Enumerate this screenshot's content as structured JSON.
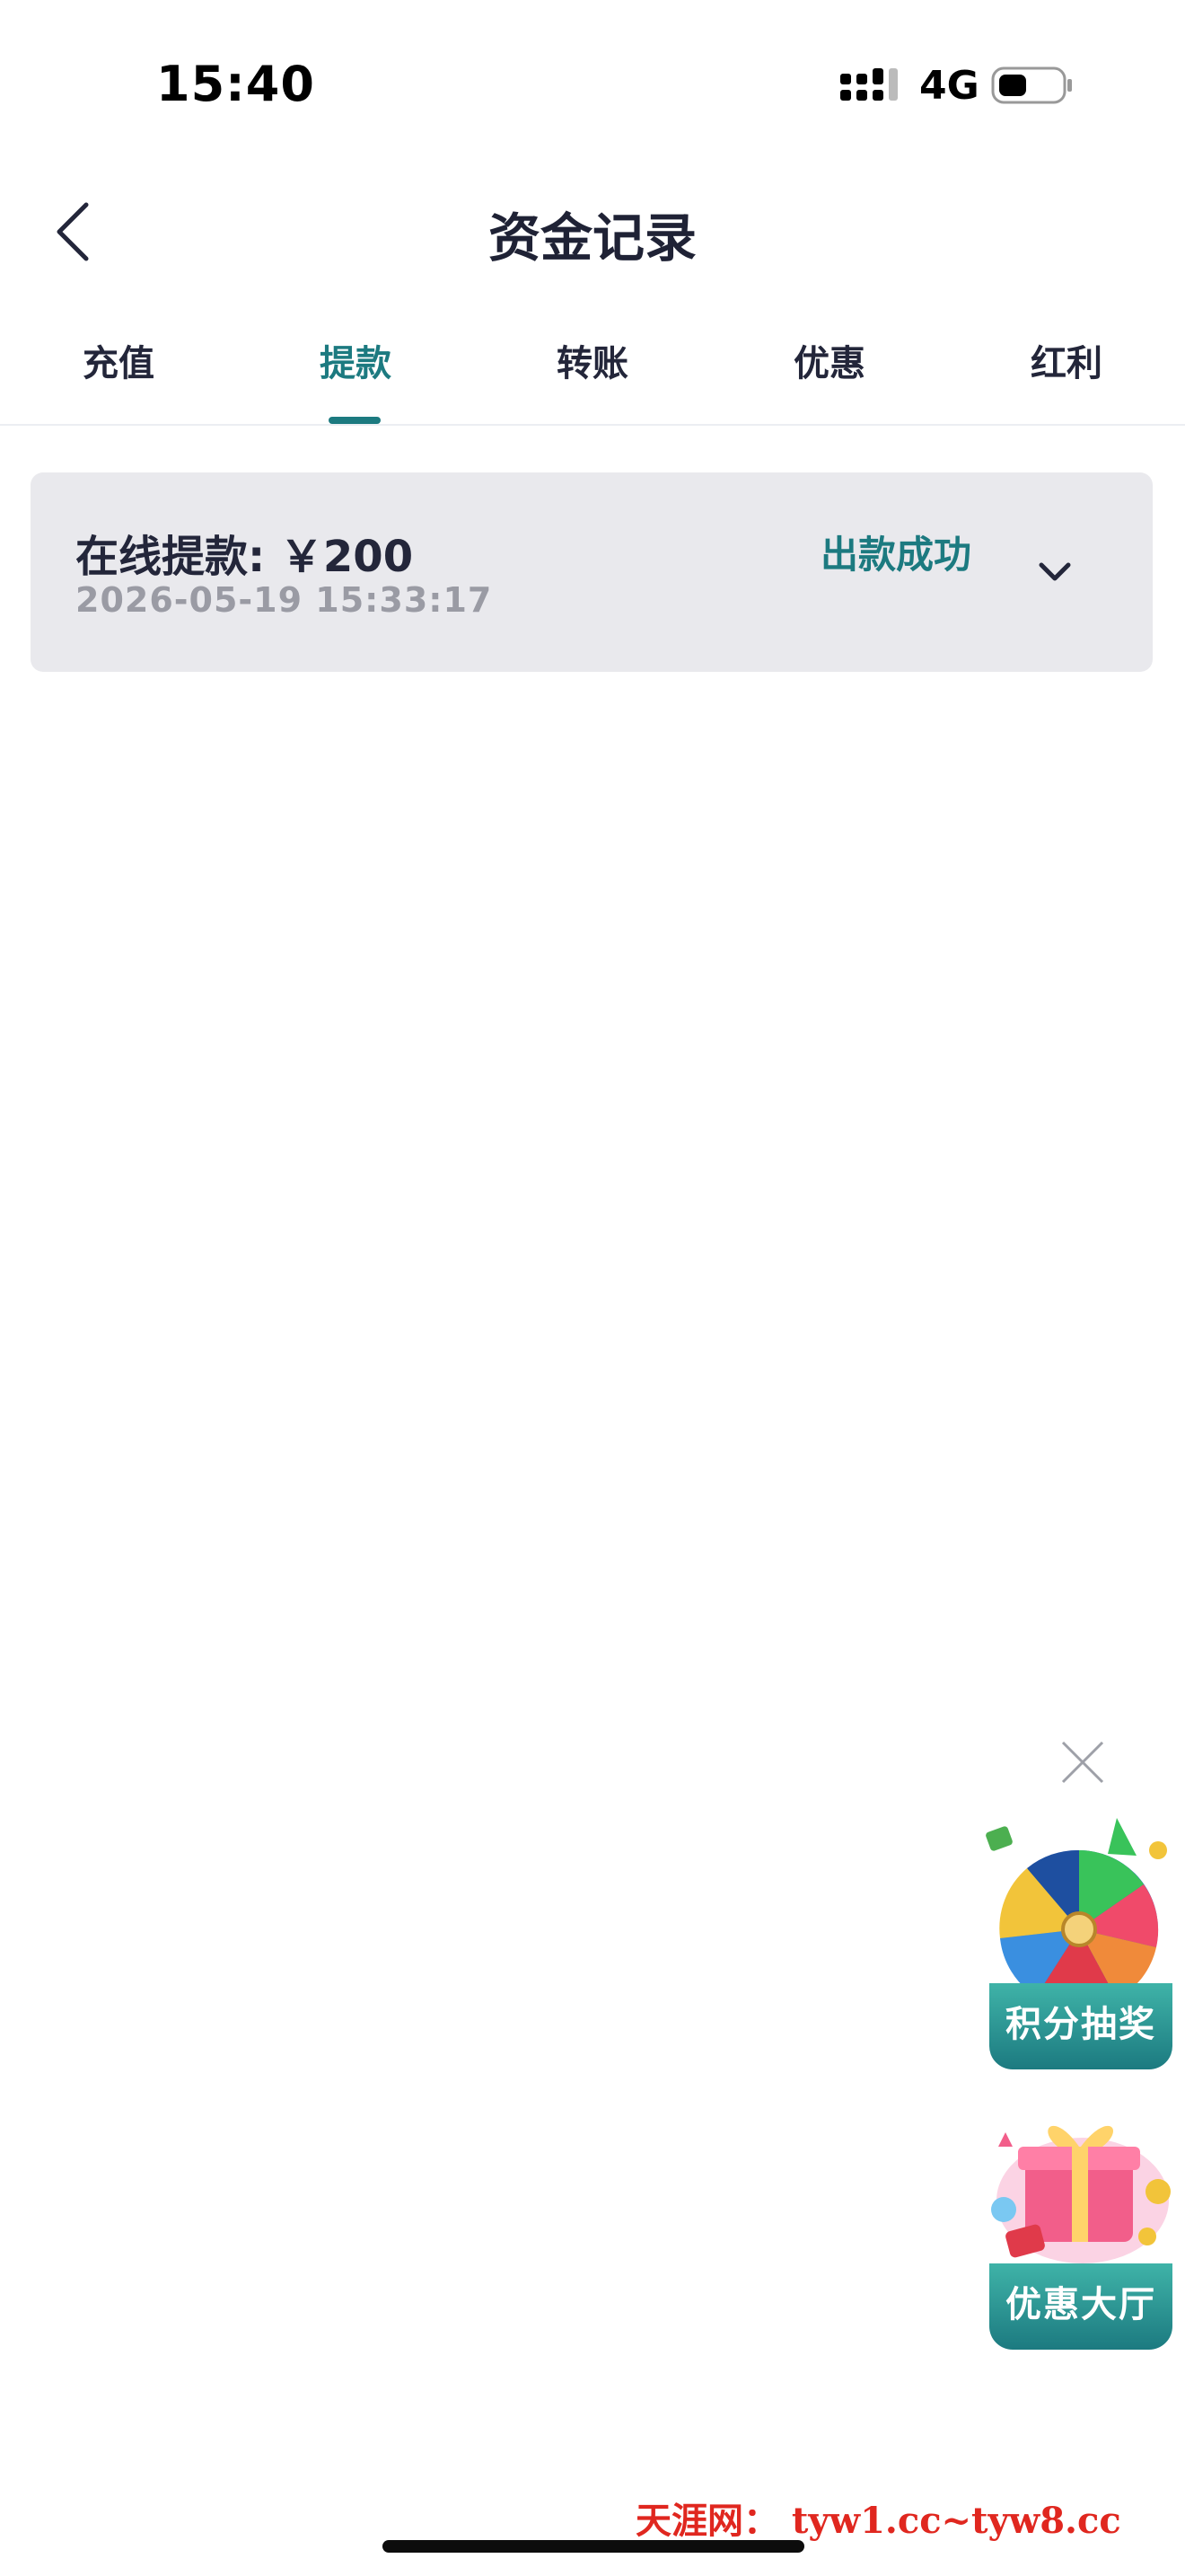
{
  "status_bar": {
    "time": "15:40",
    "network": "4G"
  },
  "header": {
    "title": "资金记录"
  },
  "tabs": [
    {
      "label": "充值",
      "active": false
    },
    {
      "label": "提款",
      "active": true
    },
    {
      "label": "转账",
      "active": false
    },
    {
      "label": "优惠",
      "active": false
    },
    {
      "label": "红利",
      "active": false
    }
  ],
  "records": [
    {
      "title": "在线提款: ￥200",
      "datetime": "2026-05-19 15:33:17",
      "status": "出款成功"
    }
  ],
  "promos": [
    {
      "label": "积分抽奖",
      "icon": "prize-wheel-icon"
    },
    {
      "label": "优惠大厅",
      "icon": "gift-box-icon"
    }
  ],
  "watermark": "天涯网： tyw1.cc~tyw8.cc",
  "colors": {
    "accent": "#1c7a80",
    "card_bg": "#e9e9ed",
    "watermark": "#e0271f"
  }
}
